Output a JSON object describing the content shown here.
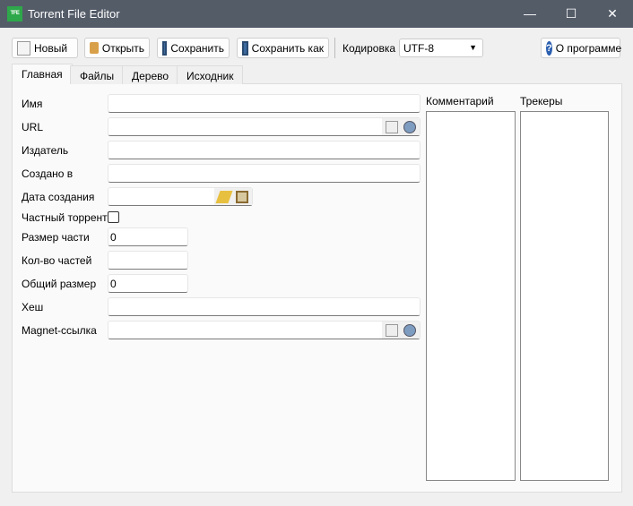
{
  "window": {
    "title": "Torrent File Editor",
    "app_icon_text": "TFE"
  },
  "toolbar": {
    "new": "Новый",
    "open": "Открыть",
    "save": "Сохранить",
    "save_as": "Сохранить как",
    "encoding_label": "Кодировка",
    "encoding_value": "UTF-8",
    "about": "О программе"
  },
  "tabs": [
    "Главная",
    "Файлы",
    "Дерево",
    "Исходник"
  ],
  "form": {
    "name": {
      "label": "Имя",
      "value": ""
    },
    "url": {
      "label": "URL",
      "value": ""
    },
    "publisher": {
      "label": "Издатель",
      "value": ""
    },
    "created_by": {
      "label": "Создано в",
      "value": ""
    },
    "creation_date": {
      "label": "Дата создания",
      "value": ""
    },
    "private": {
      "label": "Частный торрент",
      "checked": false
    },
    "piece_size": {
      "label": "Размер части",
      "value": "0"
    },
    "piece_count": {
      "label": "Кол-во частей",
      "value": ""
    },
    "total_size": {
      "label": "Общий размер",
      "value": "0"
    },
    "hash": {
      "label": "Хеш",
      "value": ""
    },
    "magnet": {
      "label": "Magnet-ссылка",
      "value": ""
    }
  },
  "comment": {
    "label": "Комментарий",
    "value": ""
  },
  "trackers": {
    "label": "Трекеры",
    "value": ""
  }
}
